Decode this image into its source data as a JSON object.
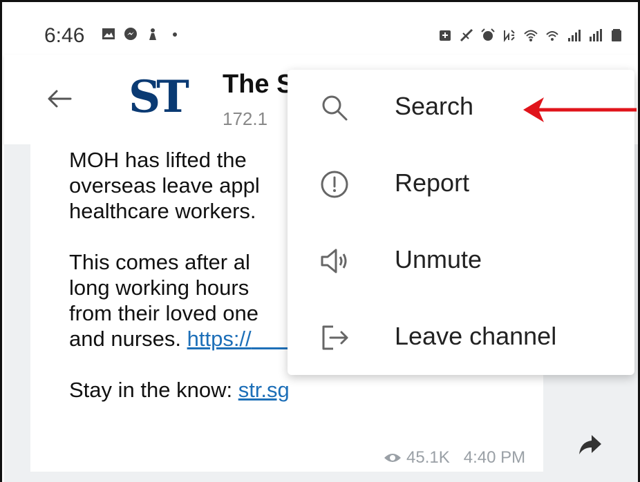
{
  "status_bar": {
    "time": "6:46",
    "left_icons": [
      "gallery-icon",
      "messenger-icon",
      "game-icon",
      "dot-icon"
    ],
    "right_icons": [
      "battery-saver-icon",
      "no-disturb-icon",
      "alarm-icon",
      "nfc-icon",
      "wifi-icon",
      "call-icon",
      "signal-icon",
      "signal-roaming-icon",
      "battery-icon"
    ]
  },
  "header": {
    "logo_text": "ST",
    "title": "The S",
    "subtitle": "172.1"
  },
  "message": {
    "lines": [
      "MOH has lifted the",
      "overseas leave appl",
      "healthcare workers."
    ],
    "lines2": [
      "This comes after al",
      "long working hours",
      "from their loved one"
    ],
    "line_last_prefix": "and nurses. ",
    "line_last_link": "https://",
    "line_last_link_tail": "                         ",
    "stay_prefix": "Stay in the know: ",
    "stay_link": "str.sg",
    "views": "45.1K",
    "time": "4:40 PM"
  },
  "menu": {
    "items": [
      {
        "label": "Search",
        "icon": "search-icon"
      },
      {
        "label": "Report",
        "icon": "report-icon"
      },
      {
        "label": "Unmute",
        "icon": "speaker-icon"
      },
      {
        "label": "Leave channel",
        "icon": "leave-icon"
      }
    ]
  },
  "colors": {
    "accent_link": "#1d6fb8",
    "logo": "#0a3a73",
    "annotation_arrow": "#e0141b"
  }
}
